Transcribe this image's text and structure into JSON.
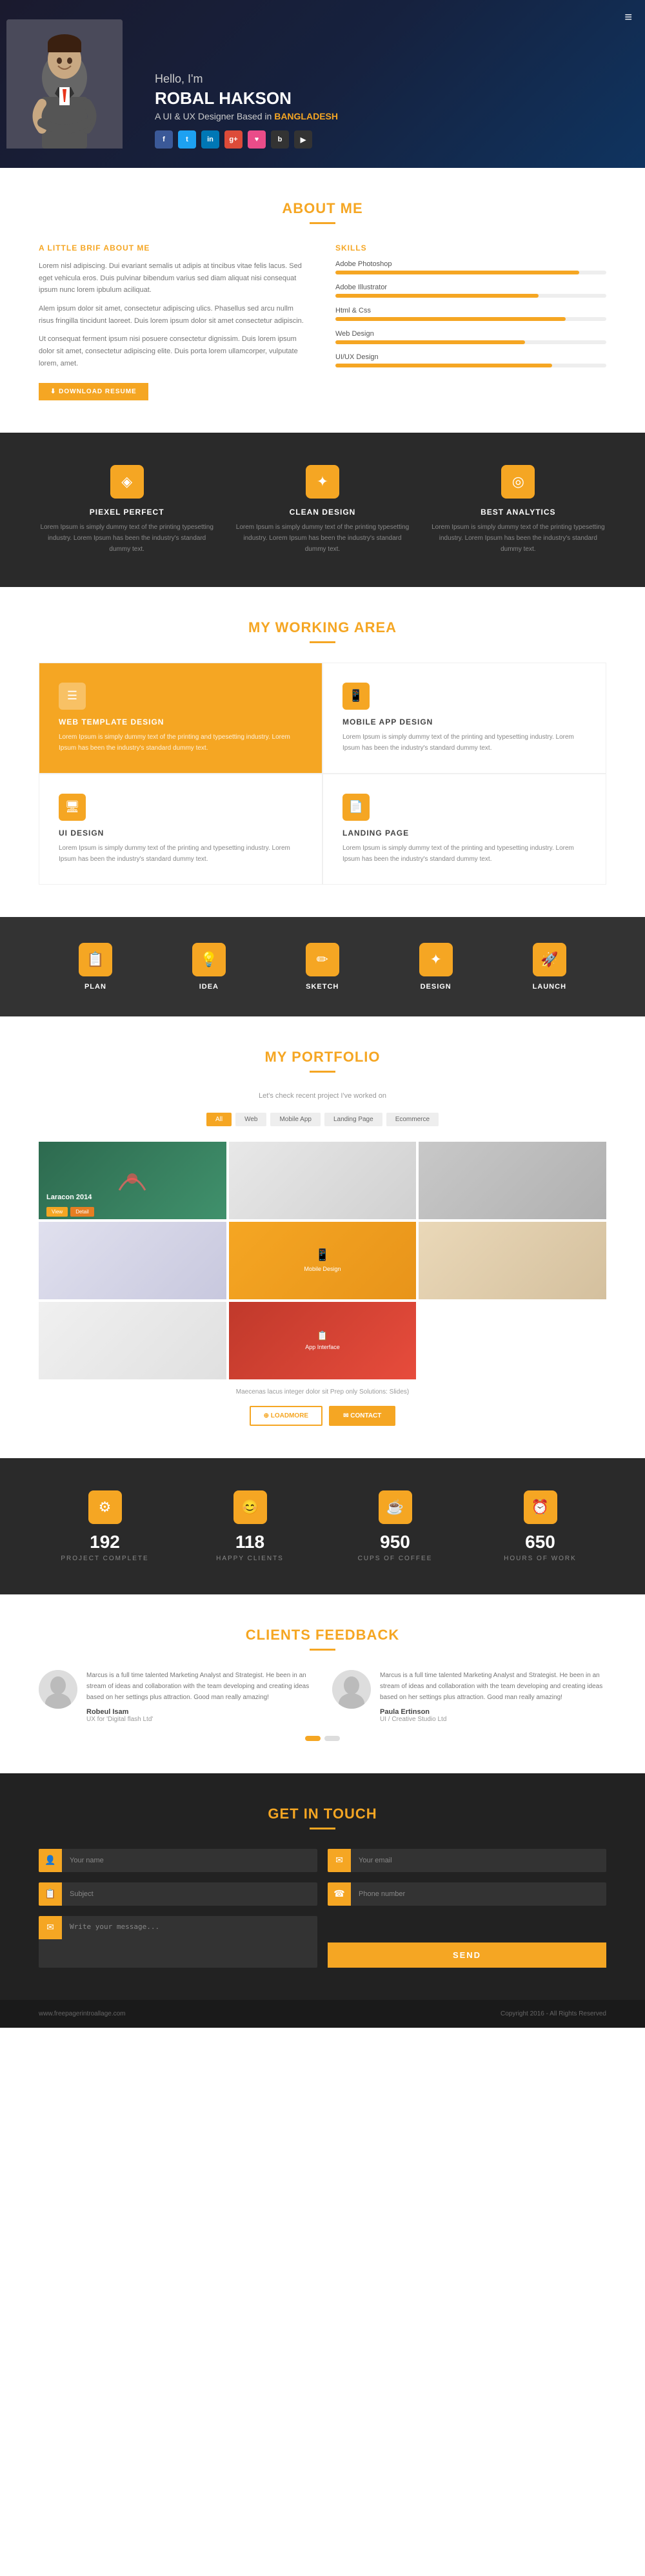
{
  "hero": {
    "greeting": "Hello, I'm",
    "name": "ROBAL HAKSON",
    "subtitle": "A UI & UX Designer Based in",
    "location": "BANGLADESH",
    "menu_icon": "≡",
    "socials": [
      {
        "label": "f",
        "class": "fb",
        "name": "facebook"
      },
      {
        "label": "t",
        "class": "tw",
        "name": "twitter"
      },
      {
        "label": "in",
        "class": "li",
        "name": "linkedin"
      },
      {
        "label": "g+",
        "class": "gp",
        "name": "googleplus"
      },
      {
        "label": "♥",
        "class": "dr",
        "name": "dribbble"
      },
      {
        "label": "b",
        "class": "bh",
        "name": "behance"
      },
      {
        "label": "▶",
        "class": "bh",
        "name": "other"
      }
    ]
  },
  "about": {
    "section_title": "ABOUT ME",
    "left_title": "A LITTLE BRIF ABOUT ME",
    "text1": "Lorem nisl adipiscing. Dui evariant semalis ut adipis at tincibus vitae felis lacus. Sed eget vehicula eros. Duis pulvinar bibendum varius sed diam aliquat nisi consequat ipsum nunc lorem ipbulum aciliquat.",
    "text2": "Alem ipsum dolor sit amet, consectetur adipiscing ulics. Phasellus sed arcu nullm risus fringilla tincidunt laoreet. Duis lorem ipsum dolor sit amet consectetur adipiscin.",
    "text3": "Ut consequat ferment ipsum nisi posuere consectetur dignissim. Duis lorem ipsum dolor sit amet, consectetur adipiscing elite. Duis porta lorem ullamcorper, vulputate lorem, amet.",
    "download_btn": "⬇ DOWNLOAD RESUME",
    "skills_title": "SKILLS",
    "skills": [
      {
        "name": "Adobe Photoshop",
        "percent": 90
      },
      {
        "name": "Adobe Illustrator",
        "percent": 75
      },
      {
        "name": "Html & Css",
        "percent": 85
      },
      {
        "name": "Web Design",
        "percent": 70
      },
      {
        "name": "UI/UX Design",
        "percent": 80
      }
    ]
  },
  "features": {
    "items": [
      {
        "icon": "◈",
        "title": "PIEXEL PERFECT",
        "text": "Lorem Ipsum is simply dummy text of the printing typesetting industry. Lorem Ipsum has been the industry's standard dummy text."
      },
      {
        "icon": "✦",
        "title": "CLEAN DESIGN",
        "text": "Lorem Ipsum is simply dummy text of the printing typesetting industry. Lorem Ipsum has been the industry's standard dummy text."
      },
      {
        "icon": "◎",
        "title": "BEST ANALYTICS",
        "text": "Lorem Ipsum is simply dummy text of the printing typesetting industry. Lorem Ipsum has been the industry's standard dummy text."
      }
    ]
  },
  "working": {
    "section_title": "MY WORKING AREA",
    "items": [
      {
        "icon": "☰",
        "title": "WEB TEMPLATE DESIGN",
        "text": "Lorem Ipsum is simply dummy text of the printing and typesetting industry. Lorem Ipsum has been the industry's standard dummy text.",
        "active": true
      },
      {
        "icon": "📱",
        "title": "MOBILE APP DESIGN",
        "text": "Lorem Ipsum is simply dummy text of the printing and typesetting industry. Lorem Ipsum has been the industry's standard dummy text.",
        "active": false
      },
      {
        "icon": "🖥",
        "title": "UI DESIGN",
        "text": "Lorem Ipsum is simply dummy text of the printing and typesetting industry. Lorem Ipsum has been the industry's standard dummy text.",
        "active": false
      },
      {
        "icon": "📄",
        "title": "LANDING PAGE",
        "text": "Lorem Ipsum is simply dummy text of the printing and typesetting industry. Lorem Ipsum has been the industry's standard dummy text.",
        "active": false
      }
    ]
  },
  "process": {
    "items": [
      {
        "icon": "📋",
        "title": "PLAN"
      },
      {
        "icon": "💡",
        "title": "IDEA"
      },
      {
        "icon": "✏",
        "title": "SKETCH"
      },
      {
        "icon": "✦",
        "title": "DESIGN"
      },
      {
        "icon": "🚀",
        "title": "LAUNCH"
      }
    ]
  },
  "portfolio": {
    "section_title": "MY PORTFOLIO",
    "section_desc": "Let's check recent project I've worked on",
    "filters": [
      {
        "label": "All",
        "active": true
      },
      {
        "label": "Web",
        "active": false
      },
      {
        "label": "Mobile App",
        "active": false
      },
      {
        "label": "Landing page",
        "active": false
      },
      {
        "label": "Ecommerce",
        "active": false
      }
    ],
    "items": [
      {
        "class": "pi-1 laracon-card",
        "label": "Laracon 2014",
        "has_btns": true
      },
      {
        "class": "pi-2",
        "label": "",
        "has_btns": false
      },
      {
        "class": "pi-3",
        "label": "",
        "has_btns": false
      },
      {
        "class": "pi-4",
        "label": "",
        "has_btns": false
      },
      {
        "class": "pi-5",
        "label": "",
        "has_btns": false
      },
      {
        "class": "pi-6",
        "label": "",
        "has_btns": false
      },
      {
        "class": "pi-7",
        "label": "",
        "has_btns": false
      },
      {
        "class": "pi-8",
        "label": "",
        "has_btns": false
      }
    ],
    "caption": "Maecenas lacus integer dolor sit Prep only Solutions: Slides)",
    "btn_more": "⊕ LOADMORE",
    "btn_contact": "✉ CONTACT"
  },
  "stats": {
    "items": [
      {
        "icon": "⚙",
        "number": "192",
        "label": "PROJECT COMPLETE"
      },
      {
        "icon": "😊",
        "number": "118",
        "label": "HAPPY CLIENTS"
      },
      {
        "icon": "☕",
        "number": "950",
        "label": "CUPS OF COFFEE"
      },
      {
        "icon": "⏰",
        "number": "650",
        "label": "HOURS OF WORK"
      }
    ]
  },
  "testimonials": {
    "section_title": "CLIENTS FEEDBACK",
    "items": [
      {
        "avatar": "👤",
        "text": "Marcus is a full time talented Marketing Analyst and Strategist. He been in an stream of ideas and collaboration with the team developing and creating ideas based on her settings plus attraction. Good man really amazing!",
        "name": "Robeul Isam",
        "role": "UX for 'Digital flash Ltd'"
      },
      {
        "avatar": "👤",
        "text": "Marcus is a full time talented Marketing Analyst and Strategist. He been in an stream of ideas and collaboration with the team developing and creating ideas based on her settings plus attraction. Good man really amazing!",
        "name": "Paula Ertinson",
        "role": "UI / Creative Studio Ltd"
      }
    ],
    "nav_dots": [
      true,
      false
    ]
  },
  "contact": {
    "section_title": "GET IN TOUCH",
    "fields": [
      {
        "icon": "👤",
        "placeholder": "Your name"
      },
      {
        "icon": "✉",
        "placeholder": "Your email"
      },
      {
        "icon": "📋",
        "placeholder": "Subject"
      },
      {
        "icon": "☎",
        "placeholder": "Phone number"
      }
    ],
    "message_placeholder": "Write your message...",
    "send_label": "SEND"
  },
  "footer": {
    "url": "www.freepagerintroallage.com",
    "copyright": "Copyright 2016 - All Rights Reserved"
  }
}
